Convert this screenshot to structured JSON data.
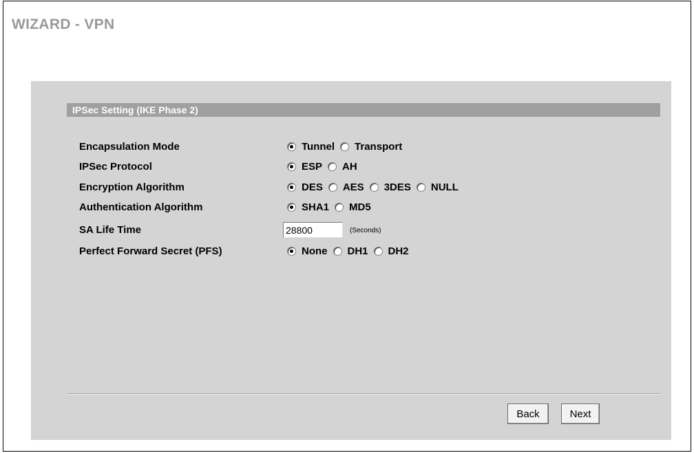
{
  "page": {
    "title": "WIZARD - VPN"
  },
  "section": {
    "title": "IPSec Setting (IKE Phase 2)"
  },
  "fields": {
    "encapsulation": {
      "label": "Encapsulation Mode",
      "options": [
        "Tunnel",
        "Transport"
      ],
      "selected": "Tunnel"
    },
    "protocol": {
      "label": "IPSec Protocol",
      "options": [
        "ESP",
        "AH"
      ],
      "selected": "ESP"
    },
    "encryption": {
      "label": "Encryption Algorithm",
      "options": [
        "DES",
        "AES",
        "3DES",
        "NULL"
      ],
      "selected": "DES"
    },
    "authentication": {
      "label": "Authentication Algorithm",
      "options": [
        "SHA1",
        "MD5"
      ],
      "selected": "SHA1"
    },
    "lifetime": {
      "label": "SA Life Time",
      "value": "28800",
      "unit": "(Seconds)"
    },
    "pfs": {
      "label": "Perfect Forward Secret (PFS)",
      "options": [
        "None",
        "DH1",
        "DH2"
      ],
      "selected": "None"
    }
  },
  "buttons": {
    "back": "Back",
    "next": "Next"
  },
  "colors": {
    "title_gray": "#999999",
    "panel_bg": "#d4d4d4",
    "header_bar": "#a0a0a0",
    "header_text": "#ffffff"
  }
}
